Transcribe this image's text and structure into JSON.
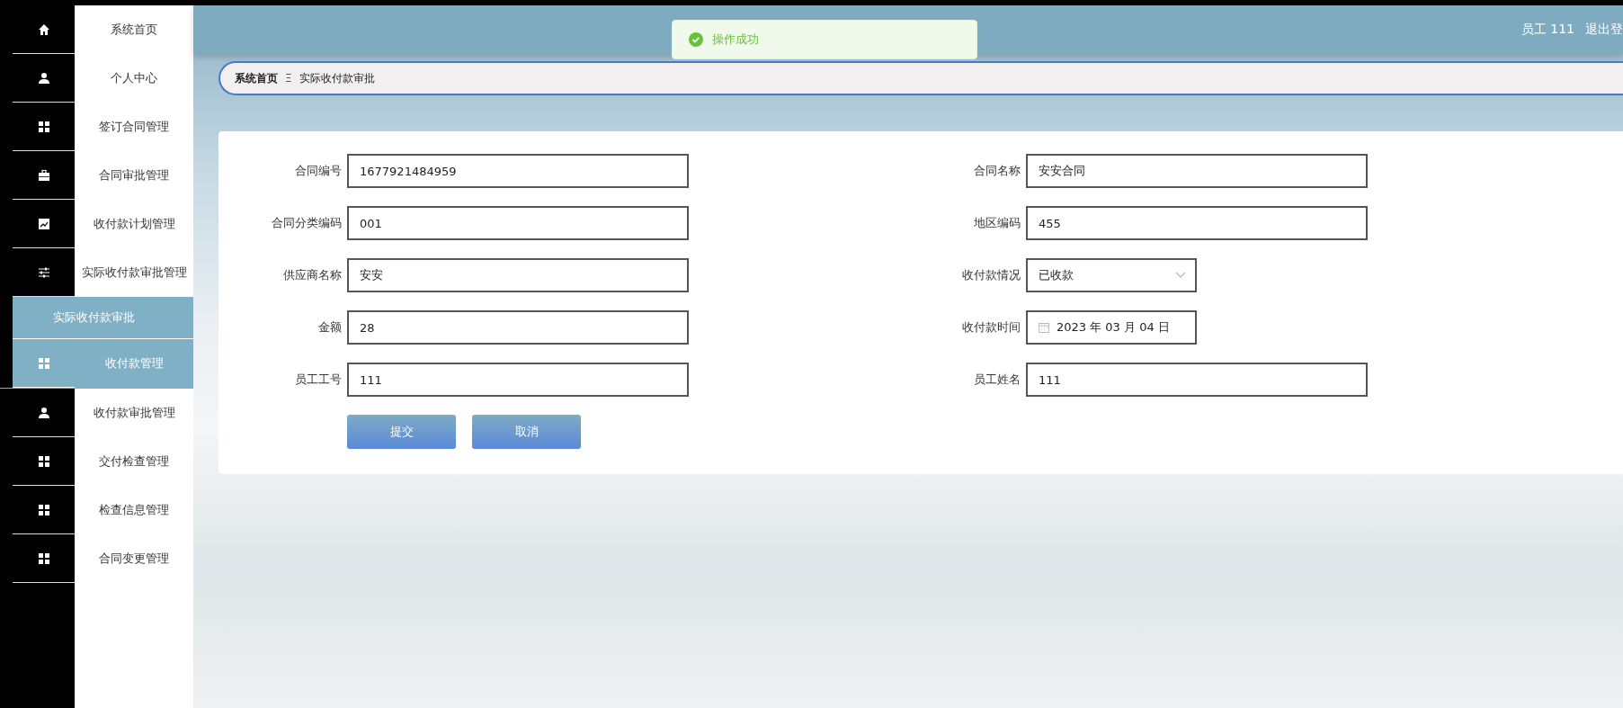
{
  "sidebar": {
    "items": [
      {
        "label": "系统首页",
        "selected": false,
        "highlighted": false
      },
      {
        "label": "个人中心",
        "selected": false,
        "highlighted": false
      },
      {
        "label": "签订合同管理",
        "selected": false,
        "highlighted": false
      },
      {
        "label": "合同审批管理",
        "selected": false,
        "highlighted": false
      },
      {
        "label": "收付款计划管理",
        "selected": false,
        "highlighted": false
      },
      {
        "label": "实际收付款审批管理",
        "selected": false,
        "highlighted": false,
        "expanded": true,
        "children": [
          {
            "label": "实际收付款审批",
            "selected": true
          }
        ]
      },
      {
        "label": "收付款管理",
        "selected": true,
        "highlighted": false
      },
      {
        "label": "收付款审批管理",
        "selected": false,
        "highlighted": false
      },
      {
        "label": "交付检查管理",
        "selected": false,
        "highlighted": false
      },
      {
        "label": "检查信息管理",
        "selected": false,
        "highlighted": false
      },
      {
        "label": "合同变更管理",
        "selected": false,
        "highlighted": false
      }
    ]
  },
  "header": {
    "user": "员工 111",
    "logout": "退出登"
  },
  "toast": {
    "message": "操作成功"
  },
  "breadcrumb": {
    "items": [
      "系统首页",
      "实际收付款审批"
    ],
    "separator": "Ξ"
  },
  "form": {
    "fields": [
      {
        "label": "合同编号",
        "kind": "text",
        "value": "1677921484959"
      },
      {
        "label": "合同名称",
        "kind": "text",
        "value": "安安合同"
      },
      {
        "label": "合同分类编码",
        "kind": "text",
        "value": "001"
      },
      {
        "label": "地区编码",
        "kind": "text",
        "value": "455"
      },
      {
        "label": "供应商名称",
        "kind": "text",
        "value": "安安"
      },
      {
        "label": "收付款情况",
        "kind": "select",
        "value": "已收款"
      },
      {
        "label": "金额",
        "kind": "text",
        "value": "28"
      },
      {
        "label": "收付款时间",
        "kind": "date",
        "value": "2023 年 03 月 04 日"
      },
      {
        "label": "员工工号",
        "kind": "text",
        "value": "111"
      },
      {
        "label": "员工姓名",
        "kind": "text",
        "value": "111"
      }
    ],
    "buttons": [
      "提交",
      "取消"
    ]
  }
}
